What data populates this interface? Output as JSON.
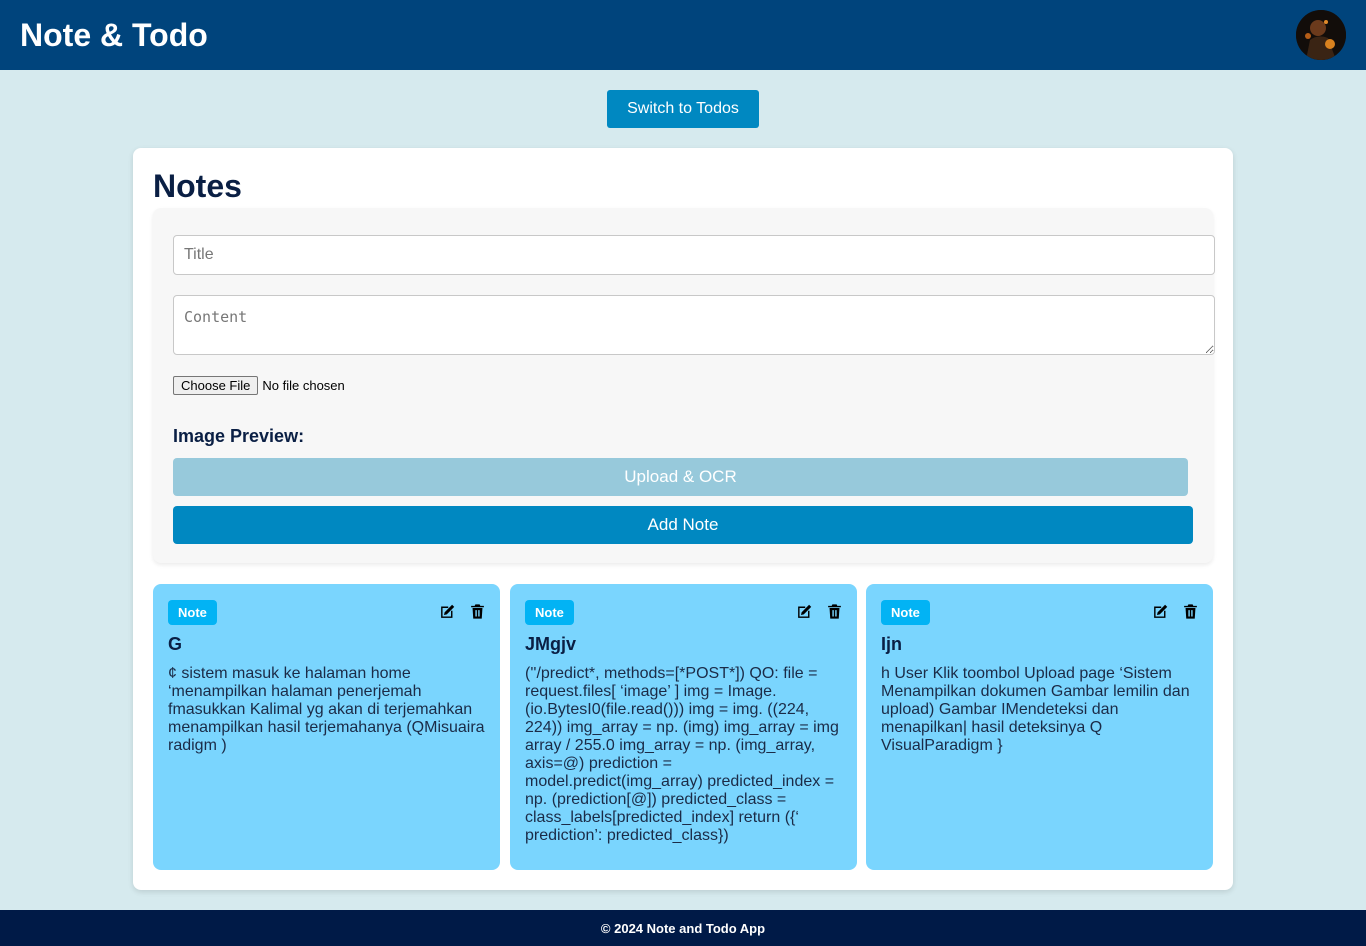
{
  "header": {
    "title": "Note & Todo"
  },
  "switch_button": {
    "label": "Switch to Todos"
  },
  "notes_section": {
    "heading": "Notes",
    "form": {
      "title_placeholder": "Title",
      "content_placeholder": "Content",
      "choose_file_label": "Choose File",
      "file_status": "No file chosen",
      "image_preview_label": "Image Preview:",
      "upload_button": "Upload & OCR",
      "add_button": "Add Note"
    },
    "notes": [
      {
        "badge": "Note",
        "title": "G",
        "content": "¢ sistem masuk ke halaman home ‘menampilkan halaman penerjemah fmasukkan Kalimal yg akan di terjemahkan menampilkan hasil terjemahanya (QMisuaira radigm )"
      },
      {
        "badge": "Note",
        "title": "JMgjv",
        "content": "(''/predict*, methods=[*POST*]) QO: file = request.files[ ‘image’ ] img = Image. (io.BytesI0(file.read())) img = img. ((224, 224)) img_array = np. (img) img_array = img array / 255.0 img_array = np. (img_array, axis=@) prediction = model.predict(img_array) predicted_index = np. (prediction[@]) predicted_class = class_labels[predicted_index] return ({‘ prediction’: predicted_class})"
      },
      {
        "badge": "Note",
        "title": "Ijn",
        "content": "h User Klik toombol Upload page ‘Sistem Menampilkan dokumen Gambar lemilin dan upload) Gambar IMendeteksi dan menapilkan| hasil deteksinya Q VisualParadigm }"
      }
    ]
  },
  "footer": {
    "text": "© 2024 Note and Todo App"
  },
  "colors": {
    "header_bg": "#00447c",
    "page_bg": "#d6eaee",
    "primary_button": "#0088c1",
    "disabled_button": "#97c9db",
    "note_bg": "#7ad5fe",
    "badge_bg": "#02b3f4",
    "footer_bg": "#001a47"
  },
  "icons": [
    "user-avatar",
    "edit-icon",
    "trash-icon"
  ]
}
